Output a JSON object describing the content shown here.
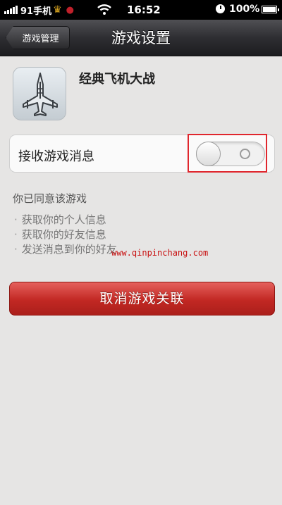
{
  "status_bar": {
    "carrier": "91手机",
    "time": "16:52",
    "battery_percent": "100%",
    "battery_level": 1.0,
    "icons": [
      "signal-icon",
      "crown-icon",
      "lips-icon",
      "wifi-icon",
      "alarm-icon",
      "battery-icon"
    ]
  },
  "nav": {
    "back_label": "游戏管理",
    "title": "游戏设置"
  },
  "game": {
    "name": "经典飞机大战",
    "icon": "plane-icon"
  },
  "settings": {
    "receive_messages_label": "接收游戏消息",
    "receive_messages_enabled": false
  },
  "permissions": {
    "heading": "你已同意该游戏",
    "items": [
      "获取你的个人信息",
      "获取你的好友信息",
      "发送消息到你的好友"
    ]
  },
  "watermark": "www.qinpinchang.com",
  "actions": {
    "unlink_label": "取消游戏关联"
  },
  "colors": {
    "accent_red": "#c22823",
    "highlight_box": "#e0262d",
    "background": "#e6e5e4"
  }
}
